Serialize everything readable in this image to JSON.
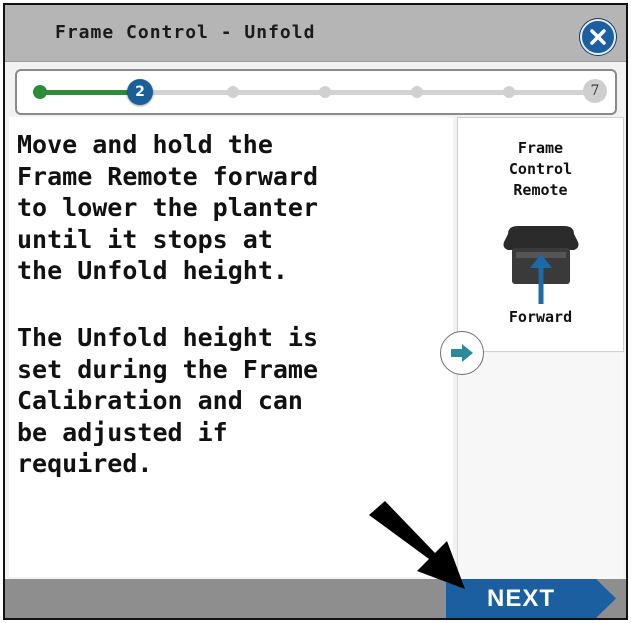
{
  "header": {
    "title": "Frame Control - Unfold",
    "close_icon": "close-x-icon"
  },
  "progress": {
    "current_step": "2",
    "total_steps": "7",
    "fraction_complete": 0.17,
    "fill_color": "#2e8b3a",
    "current_color": "#1c5e98"
  },
  "main": {
    "instruction_1": "Move and hold the\nFrame Remote forward\nto lower the planter\nuntil it stops at\nthe Unfold height.",
    "instruction_2": "The Unfold height is\nset during the Frame\nCalibration and can\nbe adjusted if\nrequired."
  },
  "side_panel": {
    "title": "Frame\nControl\nRemote",
    "direction_label": "Forward",
    "icon": "frame-remote-icon",
    "arrow_color": "#1b6aa5"
  },
  "expand_button": {
    "icon": "right-arrow-icon",
    "color": "#2a8a9a"
  },
  "footer": {
    "next_label": "NEXT",
    "next_color": "#1b5fa0",
    "bar_color": "#8e8e8e"
  },
  "annotation": {
    "icon": "callout-arrow-icon"
  }
}
